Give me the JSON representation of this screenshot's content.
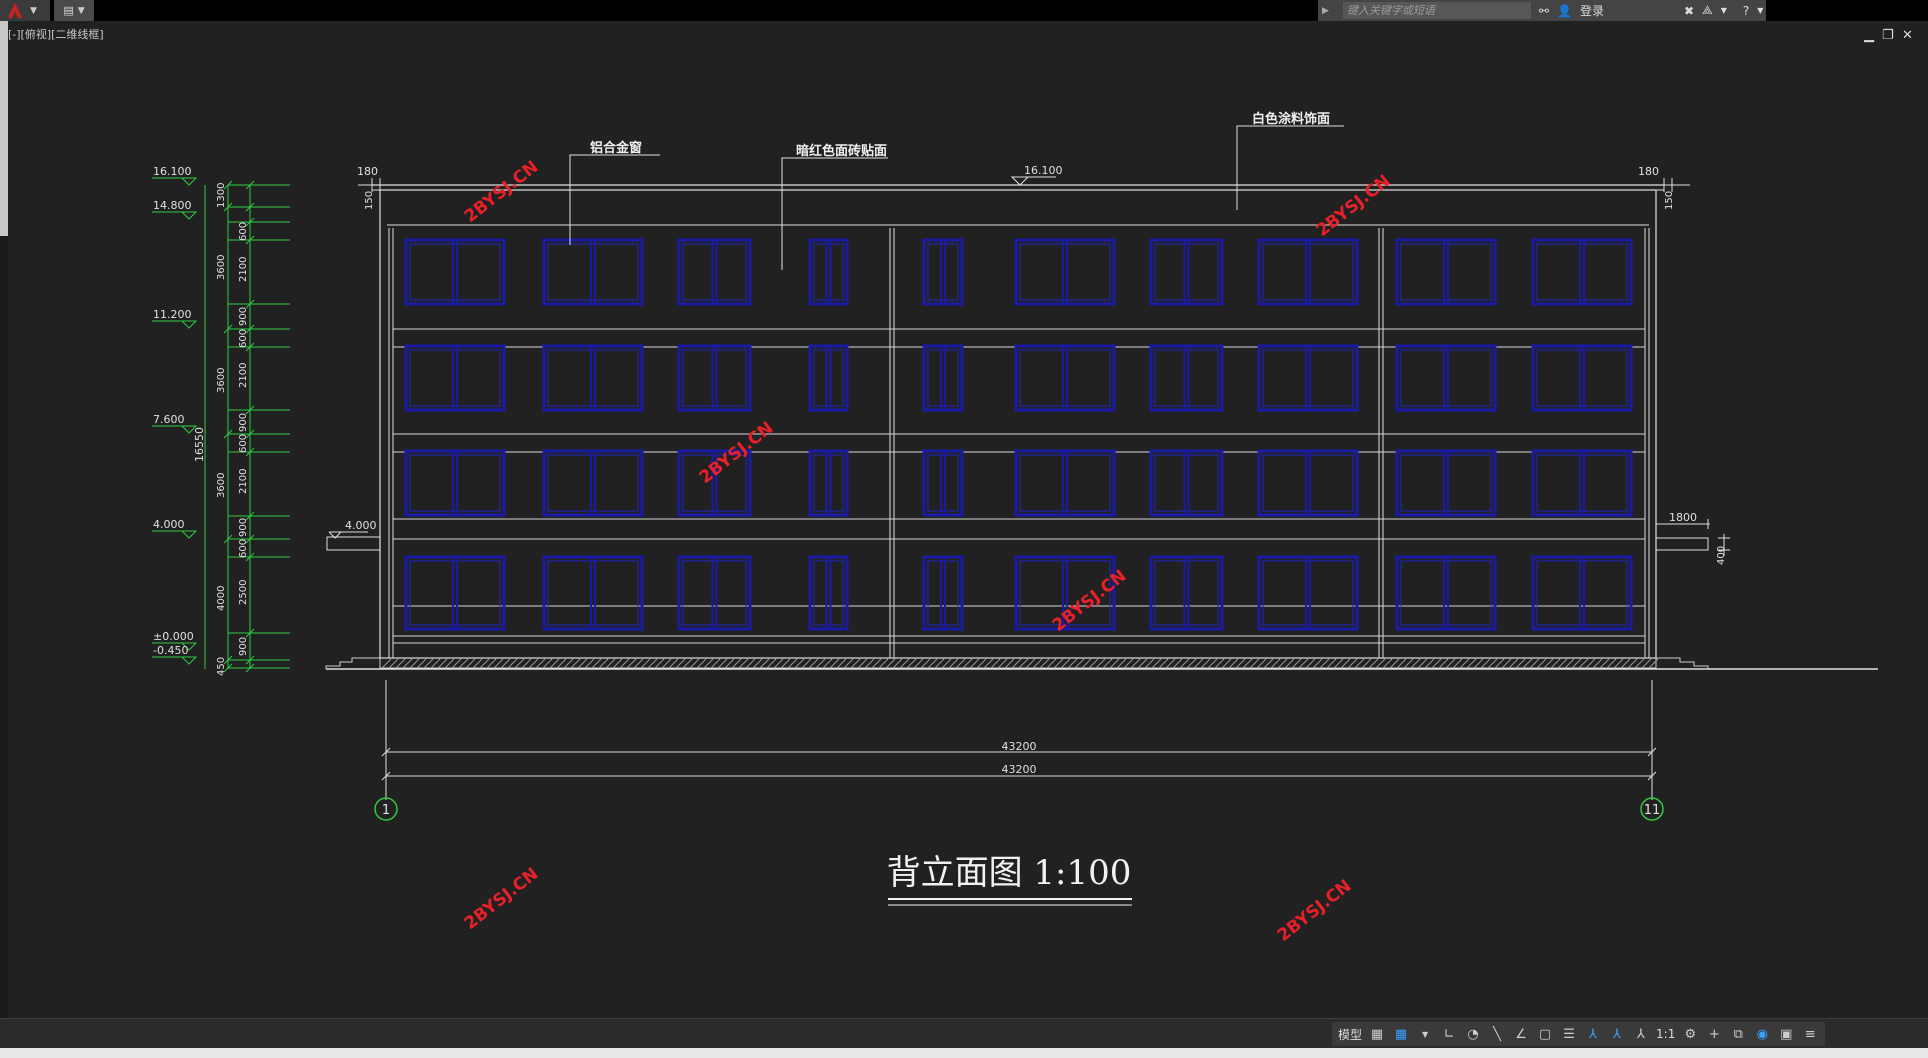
{
  "toolbar": {
    "search_placeholder": "键入关键字或短语",
    "login_label": "登录"
  },
  "viewport": {
    "label": "[-][俯视][二维线框]"
  },
  "drawing": {
    "title": "背立面图 1:100",
    "annotations": {
      "aluminum_window": "铝合金窗",
      "red_tile": "暗红色面砖贴面",
      "white_paint": "白色涂料饰面"
    },
    "levels": [
      "16.100",
      "14.800",
      "11.200",
      "7.600",
      "4.000",
      "±0.000",
      "-0.450"
    ],
    "dims_outer": [
      "1300",
      "3600",
      "3600",
      "3600",
      "4000",
      "450"
    ],
    "dims_inner": [
      "600",
      "2100",
      "900",
      "600",
      "2100",
      "900",
      "600",
      "2100",
      "900",
      "600",
      "2500",
      "900"
    ],
    "total_height": "16550",
    "roof_level": "16.100",
    "left_parapet": "180",
    "right_parapet": "180",
    "parapet_h": "150",
    "canopy_level": "4.000",
    "canopy_width": "1800",
    "canopy_height": "400",
    "overall_width_1": "43200",
    "overall_width_2": "43200",
    "axis_left": "1",
    "axis_right": "11",
    "watermark": "2BYSJ.CN"
  },
  "status": {
    "model_label": "模型",
    "scale": "1:1"
  }
}
